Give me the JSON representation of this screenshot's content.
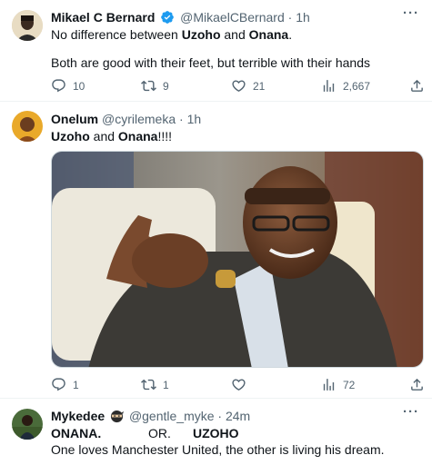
{
  "tweets": [
    {
      "display_name": "Mikael C Bernard",
      "handle": "@MikaelCBernard",
      "time": "1h",
      "verified": true,
      "line1": {
        "pre": "No difference between ",
        "b1": "Uzoho",
        "mid": " and ",
        "b2": "Onana",
        "post": "."
      },
      "line2": "Both are good with their feet, but terrible with their hands",
      "replies": "10",
      "retweets": "9",
      "likes": "21",
      "views": "2,667"
    },
    {
      "display_name": "Onelum",
      "handle": "@cyrilemeka",
      "time": "1h",
      "line1": {
        "b1": "Uzoho",
        "mid": " and ",
        "b2": "Onana",
        "post": "!!!!"
      },
      "replies": "1",
      "retweets": "1",
      "likes": "",
      "views": "72"
    },
    {
      "display_name": "Mykedee",
      "handle": "@gentle_myke",
      "time": "24m",
      "line1": {
        "a": "ONANA.",
        "b": "OR.",
        "c": "UZOHO"
      },
      "line2": "One loves Manchester United,  the other  is living his dream."
    }
  ],
  "separator": "·",
  "colors": {
    "verified": "#1d9bf0",
    "muted": "#536471",
    "text": "#0f1419",
    "divider": "#eff3f4"
  },
  "icons": [
    "reply-icon",
    "retweet-icon",
    "like-icon",
    "views-icon",
    "share-icon",
    "verified-badge-icon",
    "more-icon",
    "ninja-emoji-icon"
  ]
}
